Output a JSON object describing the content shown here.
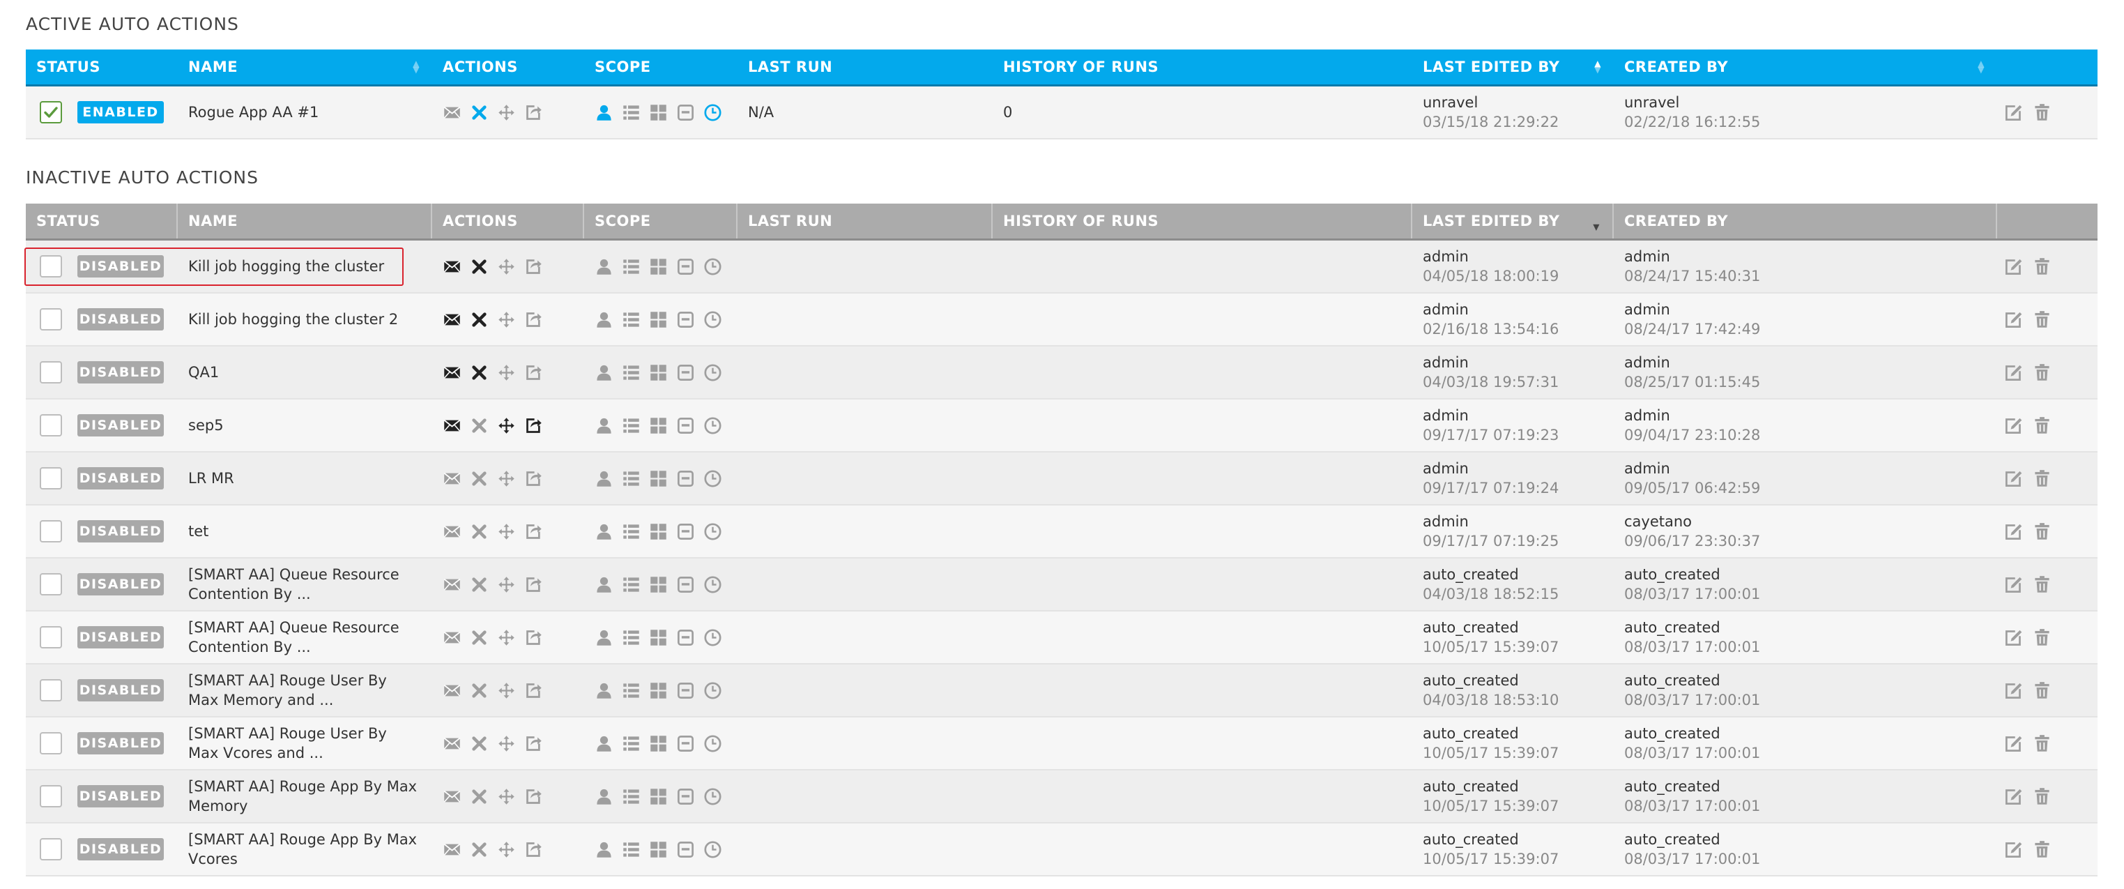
{
  "colors": {
    "accent": "#03a9ec",
    "inactive_header": "#ababab",
    "checked": "#5b9b3d",
    "highlight": "#d9232e",
    "icon_gray": "#9e9e9e",
    "icon_dark": "#222222"
  },
  "active": {
    "title": "ACTIVE AUTO ACTIONS",
    "columns": [
      "STATUS",
      "NAME",
      "ACTIONS",
      "SCOPE",
      "LAST RUN",
      "HISTORY OF RUNS",
      "LAST EDITED BY",
      "CREATED BY"
    ],
    "rows": [
      {
        "checked": true,
        "status": "ENABLED",
        "name": "Rogue App AA #1",
        "actions": [
          "email-icon",
          "cancel-icon",
          "move-icon",
          "share-icon"
        ],
        "action_states": [
          "gray",
          "blue",
          "gray",
          "gray"
        ],
        "scope": [
          "user-icon",
          "list-icon",
          "grid-icon",
          "queue-icon",
          "clock-icon"
        ],
        "scope_states": [
          "blue",
          "gray",
          "gray",
          "gray",
          "blue"
        ],
        "last_run": "N/A",
        "history": "0",
        "edited_by": "unravel",
        "edited_at": "03/15/18 21:29:22",
        "created_by": "unravel",
        "created_at": "02/22/18 16:12:55"
      }
    ]
  },
  "inactive": {
    "title": "INACTIVE AUTO ACTIONS",
    "columns": [
      "STATUS",
      "NAME",
      "ACTIONS",
      "SCOPE",
      "LAST RUN",
      "HISTORY OF RUNS",
      "LAST EDITED BY",
      "CREATED BY"
    ],
    "rows": [
      {
        "status": "DISABLED",
        "name": "Kill job hogging the cluster",
        "action_states": [
          "dark",
          "dark",
          "gray",
          "gray"
        ],
        "edited_by": "admin",
        "edited_at": "04/05/18 18:00:19",
        "created_by": "admin",
        "created_at": "08/24/17 15:40:31"
      },
      {
        "status": "DISABLED",
        "name": "Kill job hogging the cluster 2",
        "action_states": [
          "dark",
          "dark",
          "gray",
          "gray"
        ],
        "edited_by": "admin",
        "edited_at": "02/16/18 13:54:16",
        "created_by": "admin",
        "created_at": "08/24/17 17:42:49"
      },
      {
        "status": "DISABLED",
        "name": "QA1",
        "action_states": [
          "dark",
          "dark",
          "gray",
          "gray"
        ],
        "edited_by": "admin",
        "edited_at": "04/03/18 19:57:31",
        "created_by": "admin",
        "created_at": "08/25/17 01:15:45"
      },
      {
        "status": "DISABLED",
        "name": "sep5",
        "action_states": [
          "dark",
          "gray",
          "dark",
          "dark"
        ],
        "edited_by": "admin",
        "edited_at": "09/17/17 07:19:23",
        "created_by": "admin",
        "created_at": "09/04/17 23:10:28"
      },
      {
        "status": "DISABLED",
        "name": "LR MR",
        "action_states": [
          "gray",
          "gray",
          "gray",
          "gray"
        ],
        "edited_by": "admin",
        "edited_at": "09/17/17 07:19:24",
        "created_by": "admin",
        "created_at": "09/05/17 06:42:59"
      },
      {
        "status": "DISABLED",
        "name": "tet",
        "action_states": [
          "gray",
          "gray",
          "gray",
          "gray"
        ],
        "edited_by": "admin",
        "edited_at": "09/17/17 07:19:25",
        "created_by": "cayetano",
        "created_at": "09/06/17 23:30:37"
      },
      {
        "status": "DISABLED",
        "name": "[SMART AA] Queue Resource Contention By ...",
        "action_states": [
          "gray",
          "gray",
          "gray",
          "gray"
        ],
        "edited_by": "auto_created",
        "edited_at": "04/03/18 18:52:15",
        "created_by": "auto_created",
        "created_at": "08/03/17 17:00:01"
      },
      {
        "status": "DISABLED",
        "name": "[SMART AA] Queue Resource Contention By ...",
        "action_states": [
          "gray",
          "gray",
          "gray",
          "gray"
        ],
        "edited_by": "auto_created",
        "edited_at": "10/05/17 15:39:07",
        "created_by": "auto_created",
        "created_at": "08/03/17 17:00:01"
      },
      {
        "status": "DISABLED",
        "name": "[SMART AA] Rouge User By Max Memory and ...",
        "action_states": [
          "gray",
          "gray",
          "gray",
          "gray"
        ],
        "edited_by": "auto_created",
        "edited_at": "04/03/18 18:53:10",
        "created_by": "auto_created",
        "created_at": "08/03/17 17:00:01"
      },
      {
        "status": "DISABLED",
        "name": "[SMART AA] Rouge User By Max Vcores and ...",
        "action_states": [
          "gray",
          "gray",
          "gray",
          "gray"
        ],
        "edited_by": "auto_created",
        "edited_at": "10/05/17 15:39:07",
        "created_by": "auto_created",
        "created_at": "08/03/17 17:00:01"
      },
      {
        "status": "DISABLED",
        "name": "[SMART AA] Rouge App By Max Memory",
        "action_states": [
          "gray",
          "gray",
          "gray",
          "gray"
        ],
        "edited_by": "auto_created",
        "edited_at": "10/05/17 15:39:07",
        "created_by": "auto_created",
        "created_at": "08/03/17 17:00:01"
      },
      {
        "status": "DISABLED",
        "name": "[SMART AA] Rouge App By Max Vcores",
        "action_states": [
          "gray",
          "gray",
          "gray",
          "gray"
        ],
        "edited_by": "auto_created",
        "edited_at": "10/05/17 15:39:07",
        "created_by": "auto_created",
        "created_at": "08/03/17 17:00:01"
      }
    ]
  }
}
